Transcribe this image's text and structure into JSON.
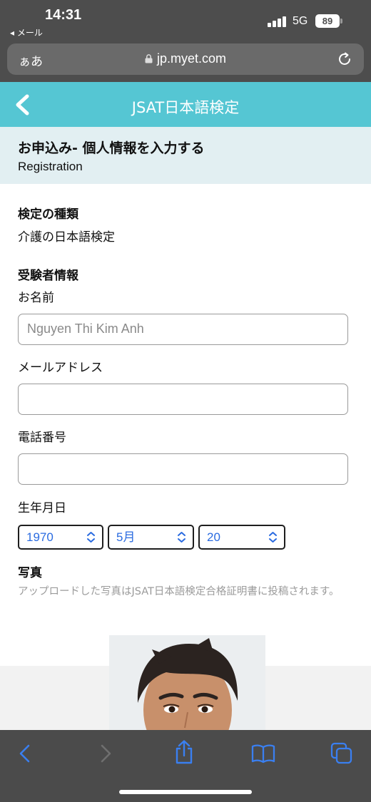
{
  "status": {
    "time": "14:31",
    "back_app": "◂ メール",
    "network": "5G",
    "battery": "89"
  },
  "browser": {
    "text_size": "ぁあ",
    "url": "jp.myet.com"
  },
  "header": {
    "title": "JSAT日本語検定"
  },
  "page": {
    "title": "お申込み- 個人情報を入力する",
    "subtitle": "Registration"
  },
  "form": {
    "exam_type_label": "検定の種類",
    "exam_type_value": "介護の日本語検定",
    "examinee_label": "受験者情報",
    "name_label": "お名前",
    "name_value": "Nguyen Thi Kim Anh",
    "email_label": "メールアドレス",
    "email_value": "",
    "phone_label": "電話番号",
    "phone_value": "",
    "birthdate_label": "生年月日",
    "birth_year": "1970",
    "birth_month": "5月",
    "birth_day": "20",
    "photo_label": "写真",
    "photo_note": "アップロードした写真はJSAT日本語検定合格証明書に投稿されます。"
  },
  "colors": {
    "header_bg": "#55c6d3",
    "subheader_bg": "#e2eff2",
    "select_text": "#2a6be0",
    "toolbar_icon": "#3a7ff0"
  },
  "icons": [
    "lock-icon",
    "reload-icon",
    "back-chevron-icon",
    "updown-icon",
    "toolbar-back-icon",
    "toolbar-forward-icon",
    "share-icon",
    "bookmarks-icon",
    "tabs-icon"
  ]
}
